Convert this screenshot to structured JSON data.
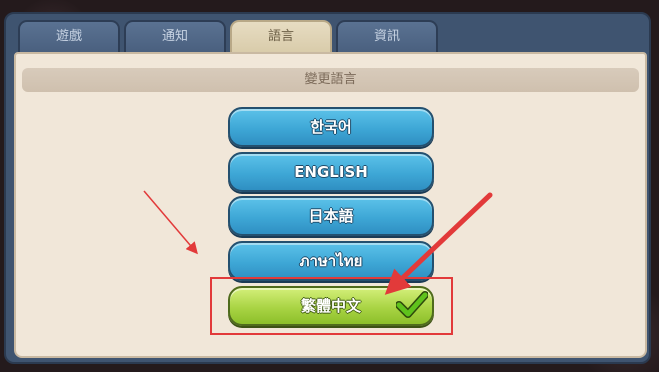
{
  "tabs": [
    {
      "label": "遊戲",
      "active": false
    },
    {
      "label": "通知",
      "active": false
    },
    {
      "label": "語言",
      "active": true
    },
    {
      "label": "資訊",
      "active": false
    }
  ],
  "panel": {
    "title": "變更語言"
  },
  "languages": [
    {
      "label": "한국어",
      "selected": false
    },
    {
      "label": "ENGLISH",
      "selected": false
    },
    {
      "label": "日本語",
      "selected": false
    },
    {
      "label": "ภาษาไทย",
      "selected": false
    },
    {
      "label": "繁體中文",
      "selected": true
    }
  ],
  "colors": {
    "frame": "#3f5470",
    "tab_active": "#e7dcc2",
    "panel_bg": "#f1e7d9",
    "button_blue": "#3ea7d6",
    "button_green": "#a9d444",
    "annotation_red": "#e23a3a"
  },
  "icons": {
    "selected_marker": "checkmark-icon"
  }
}
